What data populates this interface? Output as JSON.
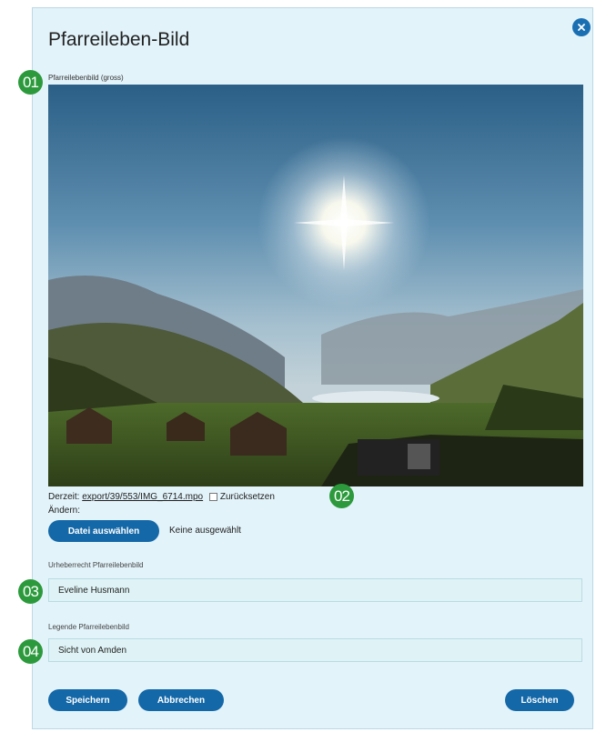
{
  "dialog": {
    "title": "Pfarreileben-Bild",
    "close_icon": "close-circle-icon"
  },
  "image_field": {
    "label": "Pfarreilebenbild (gross)",
    "current_prefix": "Derzeit:",
    "current_file": "export/39/553/IMG_6714.mpo",
    "reset_label": "Zurücksetzen",
    "change_label": "Ändern:",
    "choose_button": "Datei auswählen",
    "no_file": "Keine ausgewählt"
  },
  "copyright_field": {
    "label": "Urheberrecht Pfarreilebenbild",
    "value": "Eveline Husmann"
  },
  "legend_field": {
    "label": "Legende Pfarreilebenbild",
    "value": "Sicht von Amden"
  },
  "actions": {
    "save": "Speichern",
    "cancel": "Abbrechen",
    "delete": "Löschen"
  },
  "badges": [
    "01",
    "02",
    "03",
    "04"
  ],
  "colors": {
    "panel_bg": "#e2f3fa",
    "button": "#1468a8",
    "badge": "#2c9a3c"
  }
}
